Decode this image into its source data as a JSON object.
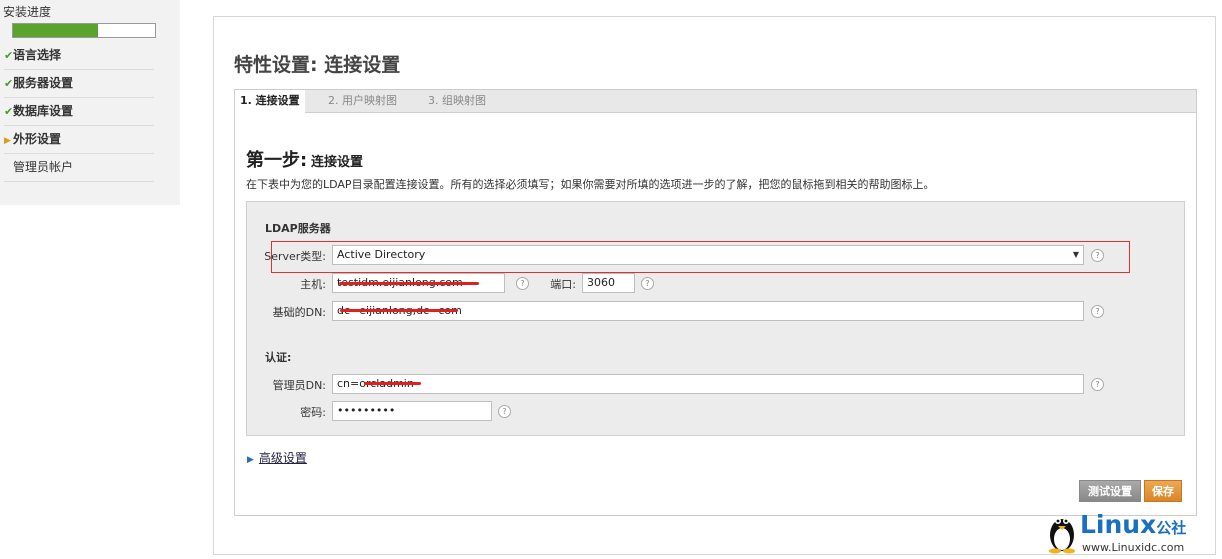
{
  "sidebar": {
    "progress_label": "安装进度",
    "progress_fraction": 0.6,
    "steps": [
      {
        "label": "语言选择",
        "status": "done"
      },
      {
        "label": "服务器设置",
        "status": "done"
      },
      {
        "label": "数据库设置",
        "status": "done"
      },
      {
        "label": "外形设置",
        "status": "current"
      },
      {
        "label": "管理员帐户",
        "status": "pending"
      }
    ]
  },
  "main": {
    "title": "特性设置: 连接设置",
    "tabs": [
      {
        "label": "1. 连接设置",
        "active": true
      },
      {
        "label": "2. 用户映射图",
        "active": false
      },
      {
        "label": "3. 组映射图",
        "active": false
      }
    ],
    "step_title_big": "第一步:",
    "step_title_small": "连接设置",
    "step_desc": "在下表中为您的LDAP目录配置连接设置。所有的选择必须填写；如果你需要对所填的选项进一步的了解，把您的鼠标拖到相关的帮助图标上。"
  },
  "form": {
    "ldap_section": "LDAP服务器",
    "server_type_label": "Server类型:",
    "server_type_value": "Active Directory",
    "host_label": "主机:",
    "host_value": "testidm.eijianlong.com",
    "port_label": "端口:",
    "port_value": "3060",
    "base_dn_label": "基础的DN:",
    "base_dn_value": "dc=eijianlong,dc=com",
    "auth_section": "认证:",
    "admin_dn_label": "管理员DN:",
    "admin_dn_value": "cn=orcladmin",
    "password_label": "密码:",
    "password_value": "•••••••••",
    "help_glyph": "?"
  },
  "actions": {
    "advanced_label": "高级设置",
    "test_button": "测试设置",
    "save_button": "保存"
  },
  "watermark": {
    "brand": "Linux",
    "brand_sub": "公社",
    "url": "www.Linuxidc.com"
  },
  "colors": {
    "progress": "#5aa42e",
    "highlight_box": "#e03030",
    "save_button": "#e0922e",
    "brand": "#1b6fc0"
  },
  "icons": {
    "done": "check-icon",
    "current": "triangle-right-icon",
    "help": "help-circle-icon",
    "dropdown": "chevron-down-icon"
  }
}
